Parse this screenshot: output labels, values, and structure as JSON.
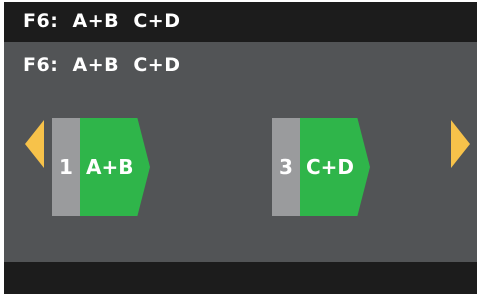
{
  "header": {
    "title": "F6:  A+B  C+D"
  },
  "main": {
    "subtitle": "F6:  A+B  C+D",
    "nav": {
      "prev_icon": "left-triangle-arrow",
      "next_icon": "right-triangle-arrow"
    },
    "tiles": [
      {
        "number": "1",
        "label": "A+B"
      },
      {
        "number": "3",
        "label": "C+D"
      }
    ]
  },
  "colors": {
    "screen_bg": "#525456",
    "bar_bg": "#1c1c1c",
    "tile_green": "#2fb54a",
    "tile_gray": "#9a9b9d",
    "arrow_yellow": "#f7c24a",
    "text": "#ffffff"
  }
}
